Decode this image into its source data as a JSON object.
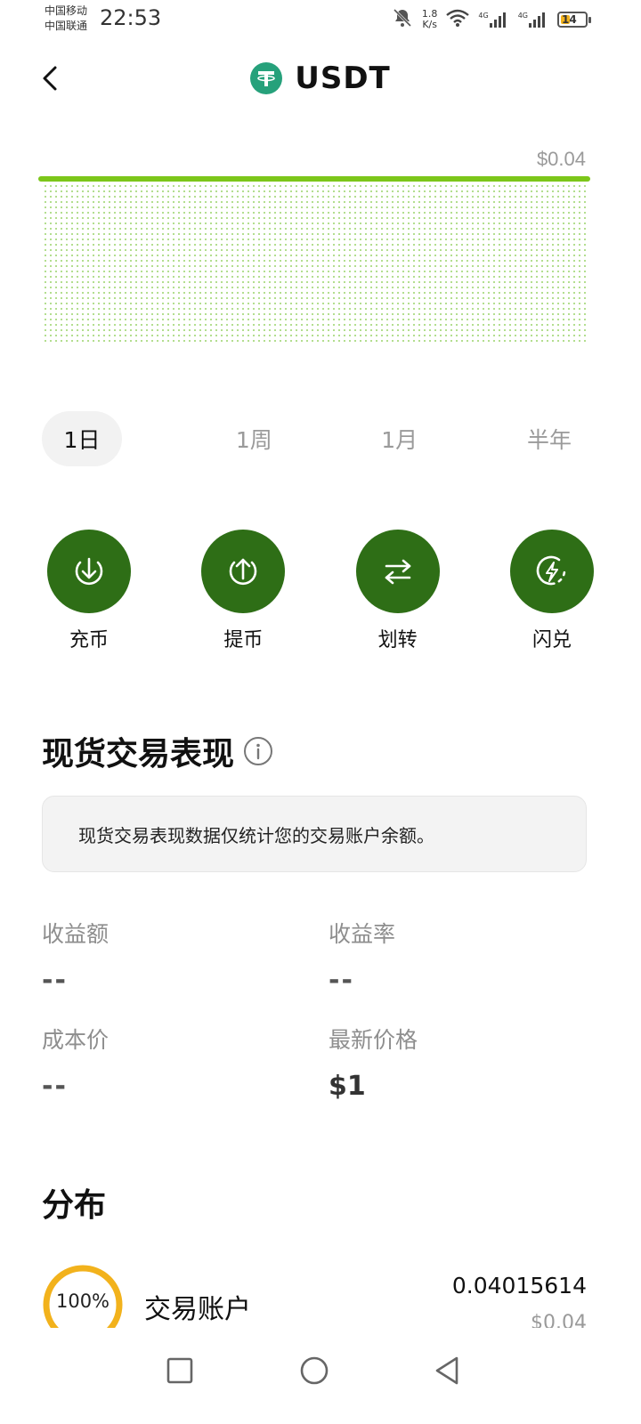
{
  "status_bar": {
    "carrier_1": "中国移动",
    "carrier_2": "中国联通",
    "time": "22:53",
    "net_speed_value": "1.8",
    "net_speed_unit": "K/s",
    "signal_1_label": "4G",
    "signal_2_label": "4G",
    "battery_level": "14"
  },
  "header": {
    "back_icon": "chevron-left-icon",
    "coin_icon": "tether-icon",
    "title": "USDT"
  },
  "chart": {
    "value_label": "$0.04",
    "line_color": "#7cc61a",
    "dot_color": "#9bd36b"
  },
  "chart_data": {
    "type": "area",
    "x": [
      "start",
      "end"
    ],
    "series": [
      {
        "values": [
          0.04,
          0.04
        ]
      }
    ],
    "annotations": [
      "$0.04"
    ]
  },
  "tabs": {
    "day": "1日",
    "week": "1周",
    "month": "1月",
    "half_year": "半年",
    "selected": "1日"
  },
  "actions": {
    "deposit": {
      "label": "充币",
      "icon": "download-circle-icon"
    },
    "withdraw": {
      "label": "提币",
      "icon": "upload-circle-icon"
    },
    "transfer": {
      "label": "划转",
      "icon": "transfer-arrows-icon"
    },
    "convert": {
      "label": "闪兑",
      "icon": "lightning-icon"
    },
    "accent": "#2e6e16"
  },
  "performance": {
    "title": "现货交易表现",
    "note": "现货交易表现数据仅统计您的交易账户余额。",
    "profit_label": "收益额",
    "profit_value": "--",
    "profit_rate_label": "收益率",
    "profit_rate_value": "--",
    "cost_label": "成本价",
    "cost_value": "--",
    "latest_price_label": "最新价格",
    "latest_price_value": "$1"
  },
  "distribution": {
    "title": "分布",
    "items": [
      {
        "percent_text": "100%",
        "percent": 100,
        "name": "交易账户",
        "amount": "0.04015614",
        "fiat": "$0.04",
        "ring_color": "#f2b21c"
      }
    ]
  },
  "nav": {
    "recent_icon": "square-icon",
    "home_icon": "circle-icon",
    "back_icon": "triangle-back-icon"
  }
}
